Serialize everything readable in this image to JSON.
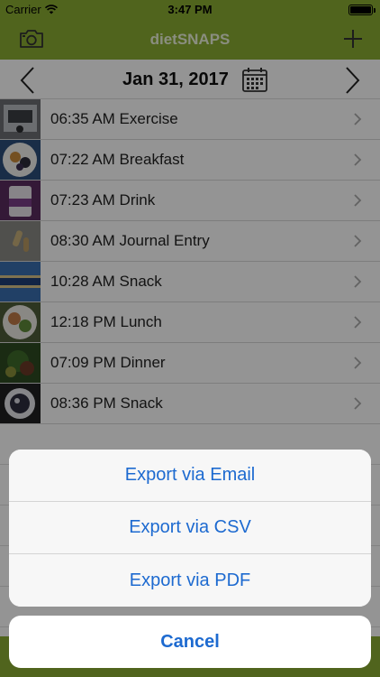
{
  "status_bar": {
    "carrier": "Carrier",
    "time": "3:47 PM"
  },
  "nav": {
    "title": "dietSNAPS"
  },
  "date_bar": {
    "date": "Jan 31, 2017"
  },
  "entries": [
    {
      "label": "06:35 AM Exercise"
    },
    {
      "label": "07:22 AM Breakfast"
    },
    {
      "label": "07:23 AM Drink"
    },
    {
      "label": "08:30 AM Journal Entry"
    },
    {
      "label": "10:28 AM Snack"
    },
    {
      "label": "12:18 PM Lunch"
    },
    {
      "label": "07:09 PM Dinner"
    },
    {
      "label": "08:36 PM Snack"
    }
  ],
  "action_sheet": {
    "email": "Export via Email",
    "csv": "Export via CSV",
    "pdf": "Export via PDF",
    "cancel": "Cancel"
  },
  "colors": {
    "accent_green": "#8aac32",
    "action_blue": "#1d6ad0"
  },
  "icons": {
    "camera": "camera-icon",
    "add": "plus-icon",
    "calendar": "calendar-icon",
    "prev": "chevron-left-icon",
    "next": "chevron-right-icon",
    "row": "chevron-right-icon"
  }
}
